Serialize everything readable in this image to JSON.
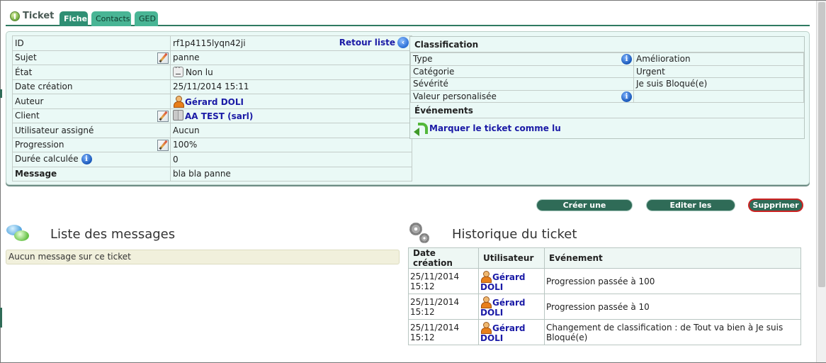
{
  "tabs": {
    "home": "Ticket",
    "items": [
      {
        "label": "Fiche",
        "active": true
      },
      {
        "label": "Contacts",
        "active": false
      },
      {
        "label": "GED",
        "active": false
      }
    ]
  },
  "ticket": {
    "id_label": "ID",
    "id_value": "rf1p4115lyqn42ji",
    "back_link": "Retour liste",
    "subject_label": "Sujet",
    "subject_value": "panne",
    "state_label": "État",
    "state_value": "Non lu",
    "created_label": "Date création",
    "created_value": "25/11/2014 15:11",
    "author_label": "Auteur",
    "author_value": "Gérard DOLI",
    "client_label": "Client",
    "client_value": "AA TEST (sarl)",
    "assigned_label": "Utilisateur assigné",
    "assigned_value": "Aucun",
    "progress_label": "Progression",
    "progress_value": "100%",
    "duration_label": "Durée calculée",
    "duration_value": "0",
    "message_label": "Message",
    "message_value": "bla bla panne"
  },
  "classification": {
    "title": "Classification",
    "type_label": "Type",
    "type_value": "Amélioration",
    "category_label": "Catégorie",
    "category_value": "Urgent",
    "severity_label": "Sévérité",
    "severity_value": "Je suis Bloqué(e)",
    "custom_label": "Valeur personalisée",
    "custom_value": "",
    "events_title": "Événements",
    "mark_read": "Marquer le ticket comme lu"
  },
  "actions": {
    "create_intervention": "Créer une intervention",
    "edit_properties": "Editer les propriétés",
    "delete": "Supprimer"
  },
  "messages": {
    "title": "Liste des messages",
    "empty": "Aucun message sur ce ticket"
  },
  "history": {
    "title": "Historique du ticket",
    "columns": [
      "Date création",
      "Utilisateur",
      "Evénement"
    ],
    "rows": [
      {
        "date": "25/11/2014 15:12",
        "user": "Gérard DOLI",
        "event": "Progression passée à 100"
      },
      {
        "date": "25/11/2014 15:12",
        "user": "Gérard DOLI",
        "event": "Progression passée à 10"
      },
      {
        "date": "25/11/2014 15:12",
        "user": "Gérard DOLI",
        "event": "Changement de classification : de Tout va bien à Je suis Bloqué(e)"
      }
    ]
  }
}
